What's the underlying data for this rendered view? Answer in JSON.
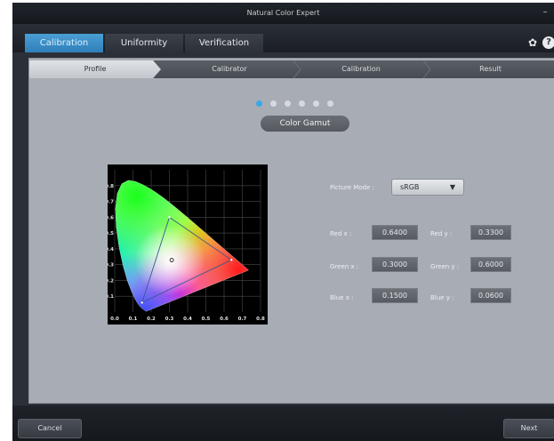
{
  "window": {
    "title": "Natural Color Expert",
    "minimize_glyph": "–"
  },
  "tabs": [
    {
      "label": "Calibration",
      "active": true
    },
    {
      "label": "Uniformity",
      "active": false
    },
    {
      "label": "Verification",
      "active": false
    }
  ],
  "icons": {
    "settings": "gear-icon",
    "help": "help-icon",
    "settings_glyph": "✿",
    "help_glyph": "?"
  },
  "steps": [
    {
      "label": "Profile",
      "active": true
    },
    {
      "label": "Calibrator",
      "active": false
    },
    {
      "label": "Calibration",
      "active": false
    },
    {
      "label": "Result",
      "active": false
    }
  ],
  "pager": {
    "total": 6,
    "current": 1
  },
  "gamut_title": "Color Gamut",
  "chart_data": {
    "type": "scatter",
    "title": "",
    "x_ticks": [
      "0.0",
      "0.1",
      "0.2",
      "0.3",
      "0.4",
      "0.5",
      "0.6",
      "0.7",
      "0.8"
    ],
    "y_ticks": [
      "0.8",
      "0.7",
      "0.6",
      "0.5",
      "0.4",
      "0.3",
      "0.2",
      "0.1"
    ],
    "xlim": [
      0,
      0.8
    ],
    "ylim": [
      0,
      0.9
    ],
    "grid": true,
    "gamut_triangle": [
      [
        0.64,
        0.33
      ],
      [
        0.3,
        0.6
      ],
      [
        0.15,
        0.06
      ]
    ],
    "white_point": [
      0.3127,
      0.329
    ],
    "spectral_locus": [
      [
        0.1741,
        0.005
      ],
      [
        0.1738,
        0.0049
      ],
      [
        0.1736,
        0.0049
      ],
      [
        0.1733,
        0.0048
      ],
      [
        0.173,
        0.0048
      ],
      [
        0.1726,
        0.0048
      ],
      [
        0.1721,
        0.0048
      ],
      [
        0.1714,
        0.0051
      ],
      [
        0.1703,
        0.0058
      ],
      [
        0.1689,
        0.0069
      ],
      [
        0.1669,
        0.0086
      ],
      [
        0.1644,
        0.0109
      ],
      [
        0.1611,
        0.0138
      ],
      [
        0.1566,
        0.0177
      ],
      [
        0.151,
        0.0227
      ],
      [
        0.144,
        0.0297
      ],
      [
        0.1355,
        0.0399
      ],
      [
        0.1241,
        0.0578
      ],
      [
        0.1096,
        0.0868
      ],
      [
        0.0913,
        0.1327
      ],
      [
        0.0687,
        0.2007
      ],
      [
        0.0454,
        0.295
      ],
      [
        0.0235,
        0.4127
      ],
      [
        0.0082,
        0.5384
      ],
      [
        0.0039,
        0.6548
      ],
      [
        0.0139,
        0.7502
      ],
      [
        0.0389,
        0.812
      ],
      [
        0.0743,
        0.8338
      ],
      [
        0.1142,
        0.8262
      ],
      [
        0.1547,
        0.8059
      ],
      [
        0.1929,
        0.7816
      ],
      [
        0.2296,
        0.7543
      ],
      [
        0.2658,
        0.7243
      ],
      [
        0.3016,
        0.6923
      ],
      [
        0.3373,
        0.6589
      ],
      [
        0.3731,
        0.6245
      ],
      [
        0.4087,
        0.5896
      ],
      [
        0.4441,
        0.5547
      ],
      [
        0.4788,
        0.5202
      ],
      [
        0.5125,
        0.4866
      ],
      [
        0.5448,
        0.4544
      ],
      [
        0.5752,
        0.4242
      ],
      [
        0.6029,
        0.3965
      ],
      [
        0.627,
        0.3725
      ],
      [
        0.6482,
        0.3514
      ],
      [
        0.6658,
        0.334
      ],
      [
        0.6801,
        0.3197
      ],
      [
        0.6915,
        0.3083
      ],
      [
        0.7006,
        0.2993
      ],
      [
        0.7079,
        0.292
      ],
      [
        0.714,
        0.2859
      ],
      [
        0.719,
        0.2809
      ],
      [
        0.723,
        0.277
      ],
      [
        0.726,
        0.274
      ],
      [
        0.7283,
        0.2717
      ],
      [
        0.73,
        0.27
      ],
      [
        0.7311,
        0.2689
      ],
      [
        0.732,
        0.268
      ],
      [
        0.7327,
        0.2673
      ],
      [
        0.7334,
        0.2666
      ],
      [
        0.734,
        0.266
      ],
      [
        0.7344,
        0.2656
      ],
      [
        0.7346,
        0.2654
      ],
      [
        0.7347,
        0.2653
      ]
    ]
  },
  "picture_mode": {
    "label": "Picture Mode :",
    "value": "sRGB",
    "arrow": "▼"
  },
  "primaries": {
    "red_x": {
      "label": "Red x :",
      "value": "0.6400"
    },
    "red_y": {
      "label": "Red y :",
      "value": "0.3300"
    },
    "green_x": {
      "label": "Green x :",
      "value": "0.3000"
    },
    "green_y": {
      "label": "Green y :",
      "value": "0.6000"
    },
    "blue_x": {
      "label": "Blue x :",
      "value": "0.1500"
    },
    "blue_y": {
      "label": "Blue y :",
      "value": "0.0600"
    }
  },
  "footer": {
    "cancel_label": "Cancel",
    "next_label": "Next"
  },
  "colors": {
    "accent": "#2f7fb9",
    "dot_active": "#39a7e6",
    "panel": "#a8adb5"
  }
}
